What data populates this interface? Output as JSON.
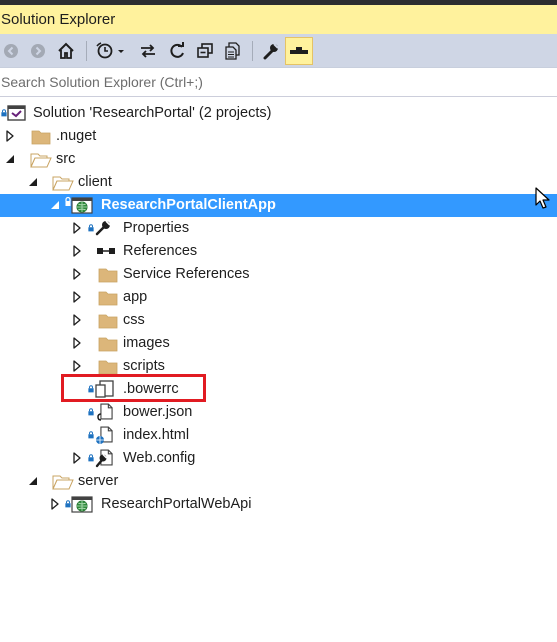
{
  "window": {
    "title": "Solution Explorer"
  },
  "toolbar": {
    "buttons": [
      {
        "icon": "back-icon",
        "enabled": false
      },
      {
        "icon": "forward-icon",
        "enabled": false
      },
      {
        "icon": "home-icon",
        "enabled": true
      },
      {
        "icon": "pending-changes-filter-icon",
        "enabled": true
      },
      {
        "icon": "sync-with-active-document-icon",
        "enabled": true
      },
      {
        "icon": "refresh-icon",
        "enabled": true
      },
      {
        "icon": "collapse-all-icon",
        "enabled": true
      },
      {
        "icon": "show-all-files-icon",
        "enabled": true
      },
      {
        "icon": "properties-wrench-icon",
        "enabled": true
      },
      {
        "icon": "preview-selected-items-icon",
        "enabled": true,
        "active": true
      }
    ]
  },
  "search": {
    "placeholder": "Search Solution Explorer (Ctrl+;)",
    "value": ""
  },
  "tree": {
    "solution_label": "Solution 'ResearchPortal' (2 projects)",
    "nuget": ".nuget",
    "src": "src",
    "client": "client",
    "client_app": "ResearchPortalClientApp",
    "properties": "Properties",
    "references": "References",
    "service_references": "Service References",
    "app": "app",
    "css": "css",
    "images": "images",
    "scripts": "scripts",
    "bowerrc": ".bowerrc",
    "bower_json": "bower.json",
    "index_html": "index.html",
    "web_config": "Web.config",
    "server": "server",
    "web_api": "ResearchPortalWebApi"
  },
  "colors": {
    "title_bar": "#fff29d",
    "toolbar": "#cfd6e5",
    "selection": "#3399ff",
    "annotation_box": "#e11b22",
    "folder": "#dcb67a"
  }
}
